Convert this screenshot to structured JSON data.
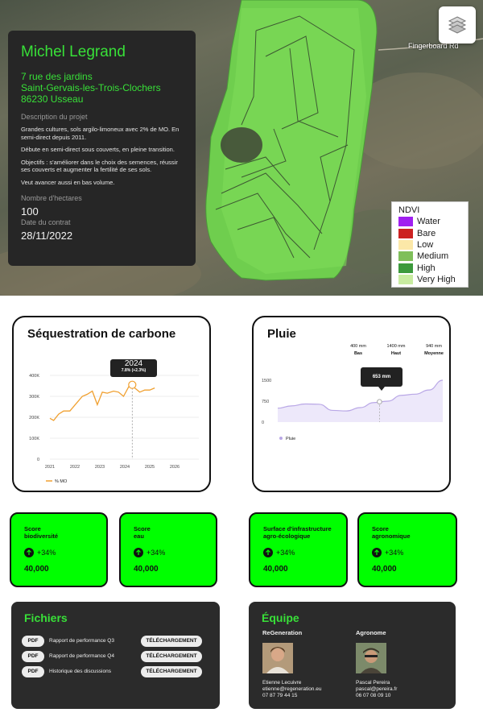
{
  "map": {
    "road_label": "Fingerboard Rd",
    "layers_icon": "layers-icon"
  },
  "farm": {
    "name": "Michel Legrand",
    "address_line1": "7 rue des jardins",
    "address_line2": "Saint-Gervais-les-Trois-Clochers",
    "address_line3": "86230  Usseau",
    "project_label": "Description du projet",
    "description": [
      "Grandes cultures, sols argilo-limoneux avec 2% de MO. En semi-direct depuis 2011.",
      "Débute en semi-direct sous couverts, en pleine transition.",
      "Objectifs : s'améliorer dans le choix des semences, réussir ses couverts et augmenter la fertilité de ses sols.",
      "Veut avancer aussi en bas volume."
    ],
    "hectares_label": "Nombre d'hectares",
    "hectares_value": "100",
    "contract_label": "Date du contrat",
    "contract_value": "28/11/2022"
  },
  "ndvi_legend": {
    "title": "NDVI",
    "items": [
      {
        "label": "Water",
        "color": "#a020f0"
      },
      {
        "label": "Bare",
        "color": "#cc2222"
      },
      {
        "label": "Low",
        "color": "#fce8a8"
      },
      {
        "label": "Medium",
        "color": "#7fbf5a"
      },
      {
        "label": "High",
        "color": "#3c9a3c"
      },
      {
        "label": "Very High",
        "color": "#c8eca0"
      }
    ]
  },
  "carbon": {
    "title": "Séquestration de carbone",
    "tooltip_year": "2024",
    "tooltip_detail": "7.8% (+2.3%)",
    "legend_label": "% MO"
  },
  "rain": {
    "title": "Pluie",
    "stats": [
      {
        "value": "400 mm",
        "label": "Bas"
      },
      {
        "value": "1400 mm",
        "label": "Haut"
      },
      {
        "value": "940 mm",
        "label": "Moyenne"
      }
    ],
    "tooltip": "653 mm",
    "legend_label": "Pluie"
  },
  "chart_data": [
    {
      "type": "line",
      "title": "Séquestration de carbone",
      "x_ticks": [
        "2021",
        "2022",
        "2023",
        "2024",
        "2025",
        "2026"
      ],
      "y_ticks": [
        "0",
        "100K",
        "200K",
        "300K",
        "400K"
      ],
      "ylim": [
        0,
        400000
      ],
      "grid": true,
      "color": "#f0a030",
      "series": [
        {
          "name": "% MO",
          "x": [
            2021.0,
            2021.15,
            2021.35,
            2021.55,
            2021.8,
            2022.05,
            2022.3,
            2022.5,
            2022.7,
            2022.9,
            2023.1,
            2023.3,
            2023.55,
            2023.75,
            2023.95,
            2024.2,
            2024.4,
            2024.6,
            2024.8,
            2025.0,
            2025.2
          ],
          "y": [
            195000,
            185000,
            215000,
            230000,
            230000,
            265000,
            300000,
            310000,
            325000,
            260000,
            320000,
            315000,
            325000,
            320000,
            300000,
            355000,
            340000,
            320000,
            330000,
            330000,
            340000
          ]
        }
      ],
      "highlight": {
        "x": "2024",
        "label": "7.8% (+2.3%)"
      }
    },
    {
      "type": "area",
      "title": "Pluie",
      "y_ticks": [
        "0",
        "750",
        "1500"
      ],
      "ylim": [
        0,
        1500
      ],
      "color": "#b9a7e6",
      "series": [
        {
          "name": "Pluie",
          "x": [
            0,
            1,
            2,
            3,
            4,
            5,
            6,
            7,
            8,
            9,
            10,
            11,
            12
          ],
          "y": [
            500,
            580,
            650,
            640,
            420,
            400,
            520,
            700,
            750,
            960,
            1000,
            1150,
            1500
          ]
        }
      ],
      "highlight": {
        "label": "653 mm"
      }
    }
  ],
  "scores": [
    {
      "title_line1": "Score",
      "title_line2": "biodiversité",
      "trend": "+34%",
      "value": "40,000"
    },
    {
      "title_line1": "Score",
      "title_line2": "eau",
      "trend": "+34%",
      "value": "40,000"
    },
    {
      "title_line1": "Surface d'infrastructure",
      "title_line2": "agro-écologique",
      "trend": "+34%",
      "value": "40,000"
    },
    {
      "title_line1": "Score",
      "title_line2": "agronomique",
      "trend": "+34%",
      "value": "40,000"
    }
  ],
  "files": {
    "title": "Fichiers",
    "items": [
      {
        "type": "PDF",
        "name": "Rapport de performance Q3",
        "action": "TÉLÉCHARGEMENT"
      },
      {
        "type": "PDF",
        "name": "Rapport de performance Q4",
        "action": "TÉLÉCHARGEMENT"
      },
      {
        "type": "PDF",
        "name": "Historique des discussions",
        "action": "TÉLÉCHARGEMENT"
      }
    ]
  },
  "team": {
    "title": "Équipe",
    "members": [
      {
        "org": "ReGeneration",
        "name": "Etienne Lecuivre",
        "email": "etienne@regeneration.eu",
        "phone": "07 87 79 44 15"
      },
      {
        "org": "Agronome",
        "name": "Pascal Pereira",
        "email": "pascal@pereira.fr",
        "phone": "06 07 08 09 10"
      }
    ]
  }
}
